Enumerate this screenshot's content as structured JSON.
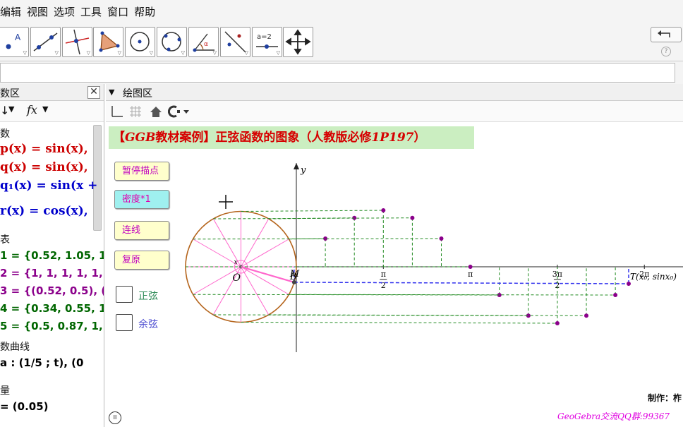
{
  "menu": [
    "编辑",
    "视图",
    "选项",
    "工具",
    "窗口",
    "帮助"
  ],
  "toolbar": {
    "undo_icon": "undo-icon",
    "help_label": "?",
    "tools": [
      {
        "name": "point-tool",
        "icon": "point-icon",
        "label": "A"
      },
      {
        "name": "line-tool",
        "icon": "line-icon"
      },
      {
        "name": "perpendicular-tool",
        "icon": "perpendicular-icon"
      },
      {
        "name": "polygon-tool",
        "icon": "polygon-icon"
      },
      {
        "name": "circle-center-tool",
        "icon": "circle-center-icon"
      },
      {
        "name": "circle-three-points-tool",
        "icon": "circle-three-points-icon"
      },
      {
        "name": "angle-tool",
        "icon": "angle-icon",
        "label": "α"
      },
      {
        "name": "reflect-tool",
        "icon": "reflect-icon"
      },
      {
        "name": "slider-tool",
        "icon": "slider-icon",
        "label": "a=2"
      },
      {
        "name": "move-view-tool",
        "icon": "move-icon"
      }
    ]
  },
  "algebra": {
    "title": "数区",
    "close": "✕",
    "tools": {
      "sort": "↓",
      "fx": "fx"
    },
    "sections": [
      {
        "heading": "数",
        "rows": [
          {
            "text": "p(x) = sin(x),",
            "color": "#cc0000"
          },
          {
            "text": "q(x) = sin(x),",
            "color": "#cc0000"
          },
          {
            "text": "q₁(x) = sin(x +",
            "color": "#0000cc"
          },
          {
            "text": "r(x) = cos(x),",
            "color": "#0000cc"
          }
        ]
      },
      {
        "heading": "表",
        "rows": [
          {
            "text": "1 = {0.52, 1.05, 1.5",
            "color": "#006600"
          },
          {
            "text": "2 = {1, 1, 1, 1, 1, 1",
            "color": "#8b008b"
          },
          {
            "text": "3 = {(0.52, 0.5), (1",
            "color": "#8b008b"
          },
          {
            "text": "4 = {0.34, 0.55, 1.5",
            "color": "#006600"
          },
          {
            "text": "5 = {0.5, 0.87, 1, 0",
            "color": "#006600"
          }
        ]
      },
      {
        "heading": "数曲线",
        "rows": [
          {
            "text": "a :  (1/5 ; t),    (0",
            "color": "#000000"
          }
        ]
      },
      {
        "heading": "量",
        "rows": [
          {
            "text": "= (0.05)",
            "color": "#000000"
          }
        ]
      }
    ]
  },
  "graphics": {
    "title": "绘图区",
    "tools": {
      "axes_icon": "axes-icon",
      "grid_icon": "grid-icon",
      "home_icon": "home-icon",
      "view_icon": "view-icon"
    },
    "banner": {
      "prefix": "【",
      "ggb": "GGB",
      "mid": "教材案例】正弦函数的图象（人教版必修",
      "ref": "1P197",
      "suffix": "）"
    },
    "buttons": [
      "暂停描点",
      "密度*1",
      "连线",
      "复原"
    ],
    "checkboxes": [
      {
        "label": "正弦",
        "color": "#2e8b57"
      },
      {
        "label": "余弦",
        "color": "#4b4bd0"
      }
    ],
    "labels": {
      "y_axis": "y",
      "origin": "O",
      "point_B": "B",
      "point_M": "M",
      "point_x": "x",
      "t_label": "T(x₀, sinx₀)",
      "tick_pi_half_num": "π",
      "tick_pi_half_den": "2",
      "tick_pi": "π",
      "tick_3pi_half_num": "3π",
      "tick_3pi_half_den": "2",
      "tick_2pi": "2π"
    },
    "credit": "制作：柞",
    "footer": "GeoGebra交流QQ群:99367",
    "pause": "II"
  },
  "chart_data": {
    "type": "scatter",
    "title": "",
    "xlabel": "",
    "ylabel": "y",
    "x_ticks": [
      "π/2",
      "π",
      "3π/2",
      "2π"
    ],
    "unit_circle": {
      "center_x": -1,
      "center_y": 0,
      "radius": 1,
      "spokes_deg": [
        0,
        30,
        60,
        90,
        120,
        150,
        180,
        210,
        240,
        270,
        300,
        330
      ]
    },
    "series": [
      {
        "name": "sin_points",
        "x": [
          0.5236,
          1.0472,
          1.5708,
          2.0944,
          2.618,
          3.1416,
          3.6652,
          4.1888,
          4.7124,
          5.236,
          5.7596
        ],
        "y": [
          0.5,
          0.866,
          1,
          0.866,
          0.5,
          0,
          -0.5,
          -0.866,
          -1,
          -0.866,
          -0.5
        ]
      }
    ],
    "current_point": {
      "x": 6.0,
      "y": -0.3
    }
  }
}
